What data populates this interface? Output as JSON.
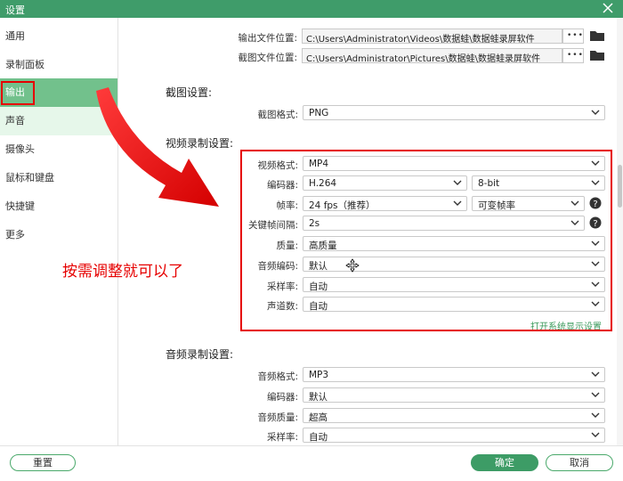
{
  "window": {
    "title": "设置"
  },
  "sidebar": {
    "items": [
      {
        "label": "通用"
      },
      {
        "label": "录制面板"
      },
      {
        "label": "输出"
      },
      {
        "label": "声音"
      },
      {
        "label": "摄像头"
      },
      {
        "label": "鼠标和键盘"
      },
      {
        "label": "快捷键"
      },
      {
        "label": "更多"
      }
    ],
    "active_index": 2,
    "hover_index": 3
  },
  "output": {
    "video_path_label": "输出文件位置:",
    "video_path": "C:\\Users\\Administrator\\Videos\\数据蛙\\数据蛙录屏软件",
    "screenshot_path_label": "截图文件位置:",
    "screenshot_path": "C:\\Users\\Administrator\\Pictures\\数据蛙\\数据蛙录屏软件",
    "browse_label": "•••"
  },
  "screenshot_settings": {
    "title": "截图设置:",
    "format_label": "截图格式:",
    "format_value": "PNG"
  },
  "video_settings": {
    "title": "视频录制设置:",
    "format_label": "视频格式:",
    "format_value": "MP4",
    "encoder_label": "编码器:",
    "encoder_value": "H.264",
    "bitdepth_value": "8-bit",
    "framerate_label": "帧率:",
    "framerate_value": "24 fps（推荐）",
    "framerate_mode_value": "可变帧率",
    "keyframe_label": "关键帧间隔:",
    "keyframe_value": "2s",
    "quality_label": "质量:",
    "quality_value": "高质量",
    "audio_codec_label": "音频编码:",
    "audio_codec_value": "默认",
    "samplerate_label": "采样率:",
    "samplerate_value": "自动",
    "channels_label": "声道数:",
    "channels_value": "自动",
    "system_display_link": "打开系统显示设置"
  },
  "audio_settings": {
    "title": "音频录制设置:",
    "format_label": "音频格式:",
    "format_value": "MP3",
    "encoder_label": "编码器:",
    "encoder_value": "默认",
    "quality_label": "音频质量:",
    "quality_value": "超高",
    "samplerate_label": "采样率:",
    "samplerate_value": "自动"
  },
  "annotation": {
    "text": "按需调整就可以了"
  },
  "footer": {
    "reset_label": "重置",
    "ok_label": "确定",
    "cancel_label": "取消"
  },
  "colors": {
    "accent": "#3f9c6a",
    "active_nav": "#72c18c",
    "highlight": "#e60000"
  }
}
